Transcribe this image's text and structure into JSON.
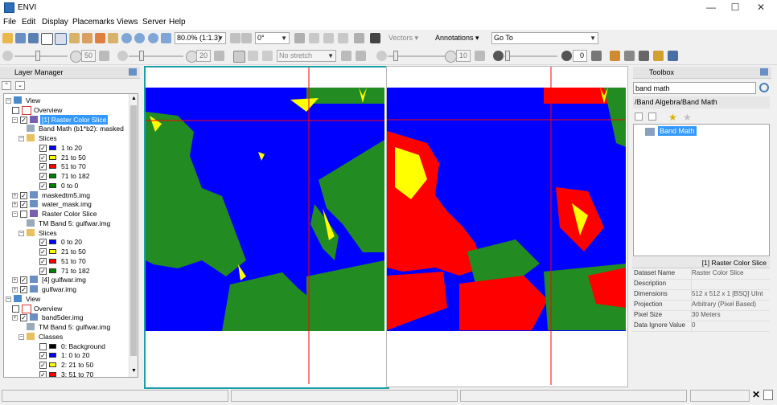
{
  "window": {
    "title": "ENVI",
    "minimize": "—",
    "maximize": "☐",
    "close": "✕"
  },
  "menu": [
    "File",
    "Edit",
    "Display",
    "Placemarks",
    "Views",
    "Server",
    "Help"
  ],
  "toolbar": {
    "zoom_value": "80.0% (1:1.3)",
    "rotation_value": "0°",
    "vectors_label": "Vectors",
    "annotations_label": "Annotations",
    "goto_value": "Go To"
  },
  "toolbar2": {
    "brightness_value": "50",
    "contrast_value": "20",
    "stretch_value": "No stretch",
    "sharpen_value": "10",
    "transparency_value": "0"
  },
  "layer_manager": {
    "title": "Layer Manager",
    "tree": [
      {
        "label": "View",
        "level": 0,
        "type": "view"
      },
      {
        "label": "Overview",
        "level": 1,
        "type": "overview"
      },
      {
        "label": "[1] Raster Color Slice",
        "level": 1,
        "type": "slice",
        "selected": true
      },
      {
        "label": "Band Math (b1*b2): masked",
        "level": 2,
        "type": "band"
      },
      {
        "label": "Slices",
        "level": 2,
        "type": "folder"
      },
      {
        "label": "1 to 20",
        "level": 3,
        "type": "class",
        "color": "#0000ff"
      },
      {
        "label": "21 to 50",
        "level": 3,
        "type": "class",
        "color": "#ffff00"
      },
      {
        "label": "51 to 70",
        "level": 3,
        "type": "class",
        "color": "#ff0000"
      },
      {
        "label": "71 to 182",
        "level": 3,
        "type": "class",
        "color": "#008000"
      },
      {
        "label": "0 to 0",
        "level": 3,
        "type": "class",
        "color": "#008000"
      },
      {
        "label": "maskedtm5.img",
        "level": 1,
        "type": "image"
      },
      {
        "label": "water_mask.img",
        "level": 1,
        "type": "image"
      },
      {
        "label": "Raster Color Slice",
        "level": 1,
        "type": "slice"
      },
      {
        "label": "TM Band 5: gulfwar.img",
        "level": 2,
        "type": "band"
      },
      {
        "label": "Slices",
        "level": 2,
        "type": "folder"
      },
      {
        "label": "0 to 20",
        "level": 3,
        "type": "class",
        "color": "#0000ff"
      },
      {
        "label": "21 to 50",
        "level": 3,
        "type": "class",
        "color": "#ffff00"
      },
      {
        "label": "51 to 70",
        "level": 3,
        "type": "class",
        "color": "#ff0000"
      },
      {
        "label": "71 to 182",
        "level": 3,
        "type": "class",
        "color": "#008000"
      },
      {
        "label": "[4] gulfwar.img",
        "level": 1,
        "type": "image"
      },
      {
        "label": "gulfwar.img",
        "level": 1,
        "type": "image"
      },
      {
        "label": "View",
        "level": 0,
        "type": "view"
      },
      {
        "label": "Overview",
        "level": 1,
        "type": "overview"
      },
      {
        "label": "band5der.img",
        "level": 1,
        "type": "image"
      },
      {
        "label": "TM Band 5: gulfwar.img",
        "level": 2,
        "type": "band"
      },
      {
        "label": "Classes",
        "level": 2,
        "type": "folder"
      },
      {
        "label": "0: Background",
        "level": 3,
        "type": "class",
        "color": "#000000"
      },
      {
        "label": "1: 0 to 20",
        "level": 3,
        "type": "class",
        "color": "#0000ff"
      },
      {
        "label": "2: 21 to 50",
        "level": 3,
        "type": "class",
        "color": "#ffff00"
      },
      {
        "label": "3: 51 to 70",
        "level": 3,
        "type": "class",
        "color": "#ff0000"
      }
    ]
  },
  "toolbox": {
    "title": "Toolbox",
    "search_value": "band math",
    "path": "/Band Algebra/Band Math",
    "result": "Band Math"
  },
  "info": {
    "title": "[1] Raster Color Slice",
    "rows": [
      {
        "key": "Dataset Name",
        "value": "Raster Color Slice"
      },
      {
        "key": "Description",
        "value": ""
      },
      {
        "key": "Dimensions",
        "value": "512 x 512 x 1 [BSQ] UInt"
      },
      {
        "key": "Projection",
        "value": "Arbitrary (Pixel Based)"
      },
      {
        "key": "Pixel Size",
        "value": "30 Meters"
      },
      {
        "key": "Data Ignore Value",
        "value": "0"
      }
    ]
  },
  "colors": {
    "water": "#0000ff",
    "land": "#228b22",
    "low": "#ffff00",
    "mid": "#ff0000",
    "frame_active": "#1aa0a8",
    "crosshair": "#ff0000"
  }
}
